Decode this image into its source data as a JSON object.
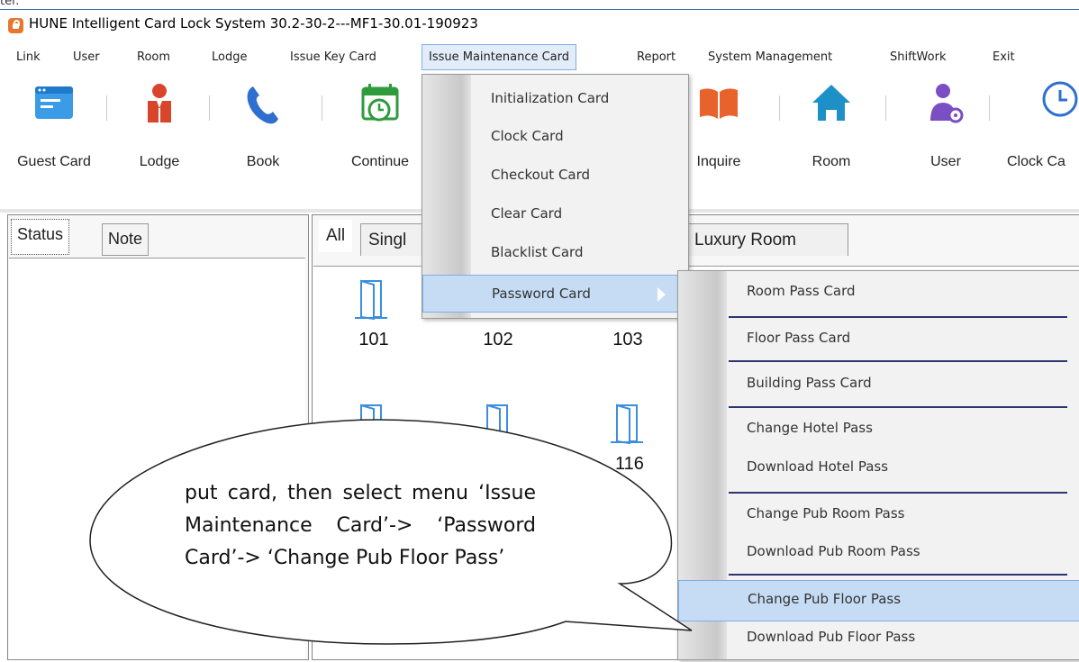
{
  "window": {
    "title": "HUNE Intelligent Card Lock System 30.2-30-2---MF1-30.01-190923"
  },
  "crop_top_text": "ter.",
  "menubar": {
    "items": [
      "Link",
      "User",
      "Room",
      "Lodge",
      "Issue Key Card",
      "Issue Maintenance Card",
      "Report",
      "System Management",
      "ShiftWork",
      "Exit"
    ]
  },
  "toolbar": {
    "tools": [
      {
        "label": "Guest Card",
        "icon": "guest-card-icon"
      },
      {
        "label": "Lodge",
        "icon": "lodge-person-icon"
      },
      {
        "label": "Book",
        "icon": "phone-icon"
      },
      {
        "label": "Continue",
        "icon": "calendar-clock-icon"
      },
      {
        "label": "Inquire",
        "icon": "book-icon"
      },
      {
        "label": "Room",
        "icon": "house-icon"
      },
      {
        "label": "User",
        "icon": "user-gear-icon"
      },
      {
        "label": "Clock Ca",
        "icon": "clock-icon"
      }
    ]
  },
  "left_tabs": [
    "Status",
    "Note"
  ],
  "room_tabs": [
    "All",
    "Singl",
    "Luxury Room"
  ],
  "rooms": [
    "101",
    "102",
    "103",
    "116"
  ],
  "maintenance_menu": {
    "items": [
      "Initialization Card",
      "Clock Card",
      "Checkout Card",
      "Clear Card",
      "Blacklist Card",
      "Password Card"
    ]
  },
  "password_submenu": {
    "items": [
      "Room Pass Card",
      "Floor Pass Card",
      "Building Pass Card",
      "Change Hotel Pass",
      "Download Hotel Pass",
      "Change Pub Room Pass",
      "Download Pub Room Pass",
      "Change Pub Floor Pass",
      "Download Pub Floor Pass"
    ]
  },
  "callout": {
    "text": "put card, then select menu ‘Issue Maintenance Card’-> ‘Password Card’-> ‘Change Pub Floor Pass’"
  },
  "colors": {
    "accent": "#3b8ede",
    "lodge_red": "#d9452b",
    "book_blue": "#2f6fcf",
    "continue_green": "#2f9b3d",
    "menu_highlight": "#c5dcf4",
    "separator": "#2d3470"
  }
}
